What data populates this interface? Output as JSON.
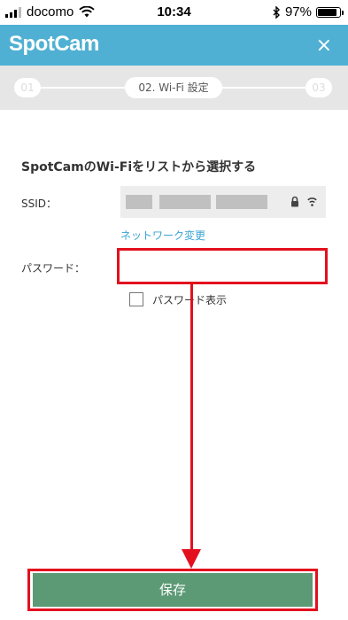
{
  "status_bar": {
    "carrier": "docomo",
    "time": "10:34",
    "battery": "97%",
    "battery_level": 0.97
  },
  "header": {
    "logo": "SpotCam",
    "close_symbol": "×"
  },
  "stepper": {
    "step1": "01",
    "current": "02. Wi-Fi 設定",
    "step3": "03"
  },
  "form": {
    "title": "SpotCamのWi-Fiをリストから選択する",
    "ssid_label": "SSID：",
    "network_change": "ネットワーク変更",
    "password_label": "パスワード：",
    "password_value": "",
    "show_password_label": "パスワード表示",
    "show_password_checked": false
  },
  "footer": {
    "save_label": "保存"
  },
  "colors": {
    "header": "#4fb0d3",
    "accent_link": "#39a3d4",
    "save_button": "#5b9a75",
    "highlight": "#e3101e"
  }
}
